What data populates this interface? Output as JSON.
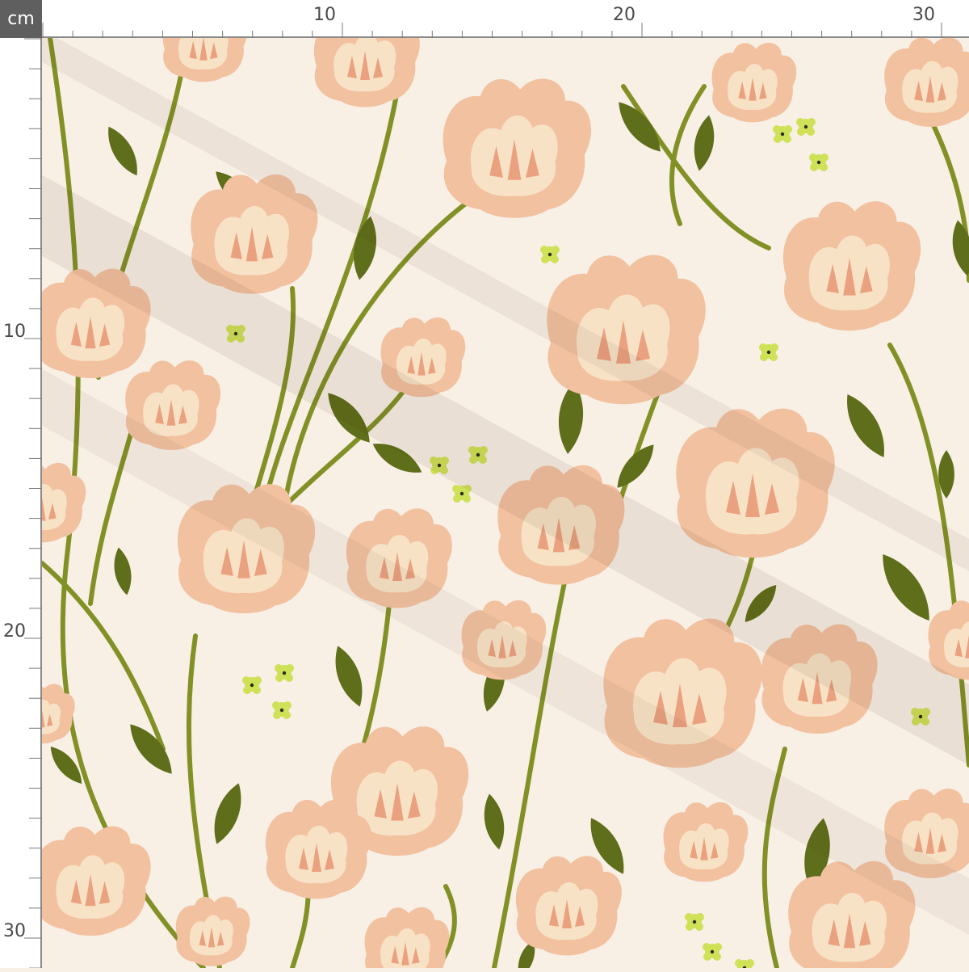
{
  "ruler": {
    "unit": "cm",
    "top_labels": [
      "10",
      "20",
      "30"
    ],
    "left_labels": [
      "10",
      "20",
      "30"
    ]
  },
  "pattern": {
    "motif": "peach-poppy-flower",
    "colors": {
      "background": "#f8efe5",
      "petal": "#f2c1a0",
      "petal_inner": "#f8e2c6",
      "petal_accent": "#eaa17f",
      "stem": "#829126",
      "leaf": "#5f6e1a",
      "small_flower": "#cfe157",
      "ruler_bg": "#ffffff",
      "ruler_text": "#4a4a4a",
      "corner_bg": "#5f5f5f"
    }
  }
}
